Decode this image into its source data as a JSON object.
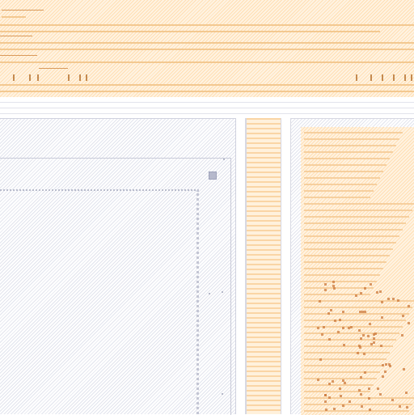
{
  "header": {
    "toolbar_left": [
      {
        "icon": "toolbar-icon-1"
      },
      {
        "icon": "toolbar-icon-2"
      },
      {
        "icon": "toolbar-icon-3"
      }
    ],
    "toolbar_right": [
      {
        "icon": "toolbar-icon-4"
      },
      {
        "icon": "toolbar-icon-5"
      },
      {
        "icon": "toolbar-icon-6"
      }
    ]
  },
  "workspace": {
    "corner_button_icon": "resize-handle-icon"
  },
  "colors": {
    "accent": "#f2c48a",
    "accent_dark": "#c58a4f",
    "border": "#cfd1df"
  }
}
